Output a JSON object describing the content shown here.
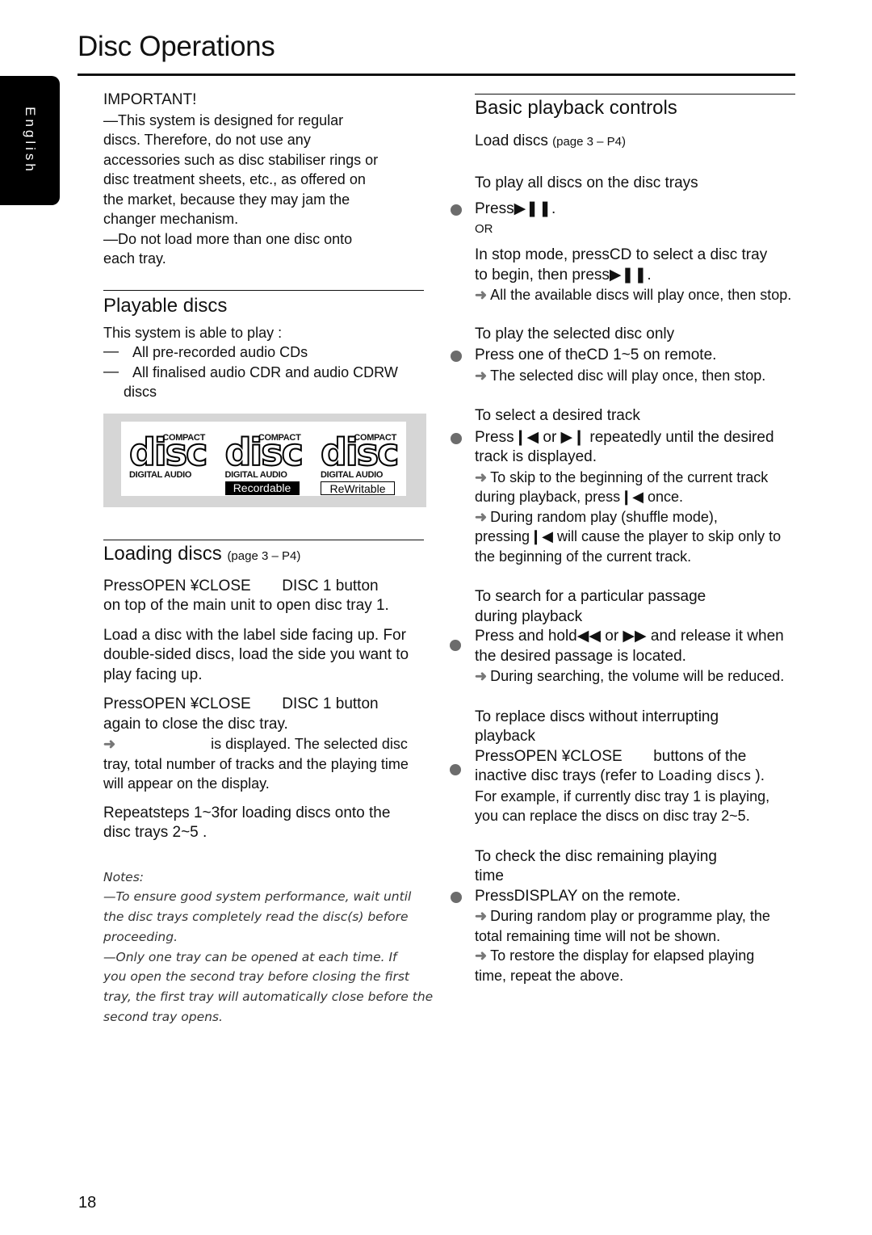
{
  "page": {
    "title": "Disc Operations",
    "language_tab": "English",
    "page_number": "18"
  },
  "important": {
    "heading": "IMPORTANT!",
    "lines": [
      "—This system is designed for regular",
      "discs. Therefore, do not use any",
      "accessories such as disc stabiliser rings or",
      "disc treatment sheets, etc., as offered on",
      "the market, because they may jam the",
      "changer mechanism.",
      "—Do not load more than one disc onto",
      "each tray."
    ]
  },
  "playable_discs": {
    "heading": "Playable discs",
    "intro": "This system is able to play :",
    "dash": "—",
    "items": [
      "All pre-recorded audio CDs",
      "All finalised audio CDR and audio CDRW",
      "discs"
    ],
    "logos": [
      {
        "top": "COMPACT",
        "word": "disc",
        "bottom": "DIGITAL AUDIO",
        "badge": ""
      },
      {
        "top": "COMPACT",
        "word": "disc",
        "bottom": "DIGITAL AUDIO",
        "badge": "Recordable"
      },
      {
        "top": "COMPACT",
        "word": "disc",
        "bottom": "DIGITAL AUDIO",
        "badge": "ReWritable"
      }
    ]
  },
  "loading_discs": {
    "heading": "Loading discs",
    "ref": "(page 3 – P4)",
    "step1_a": "PressOPEN ¥CLOSE",
    "step1_b": "DISC 1  button",
    "step1_c": "on top of the main unit to open disc tray 1.",
    "step2": [
      "Load a disc with the label side facing up. For",
      "double-sided discs, load the side you want to",
      "play facing up."
    ],
    "step3_a": "PressOPEN ¥CLOSE",
    "step3_b": "DISC 1  button",
    "step3_c": "again to close the disc tray.",
    "step3_arrow": "➜",
    "step3_d": "is displayed. The selected disc",
    "step3_e": "tray, total number of tracks and the playing time",
    "step3_f": "will appear on the display.",
    "step4": [
      "Repeatsteps 1~3for loading discs onto the",
      "disc trays 2~5 ."
    ],
    "notes_heading": "Notes:",
    "notes": [
      "—To ensure good system performance, wait until",
      "the disc trays completely read the disc(s) before",
      "proceeding.",
      "—Only one tray can be opened at each time.  If",
      "you open the second tray before closing the first",
      "tray, the first tray will automatically close before the",
      "second tray opens."
    ]
  },
  "basic_playback": {
    "heading": "Basic playback controls",
    "load_label": "Load discs",
    "load_ref": "(page 3 – P4)",
    "arrow": "➜",
    "play_all": {
      "title": "To play all discs on the disc trays",
      "step": "Press▶❚❚.",
      "or": "OR",
      "alt": [
        "In stop mode, pressCD  to select a disc tray",
        "to begin, then press▶❚❚."
      ],
      "note": "All the available discs will play once, then stop."
    },
    "play_selected": {
      "title": "To play the selected disc only",
      "step": "Press one of theCD 1~5  on remote.",
      "note": "The selected disc will play once, then stop."
    },
    "select_track": {
      "title": "To select a desired track",
      "step": [
        "Press❙◀  or  ▶❙  repeatedly until the desired",
        "track is displayed."
      ],
      "note1": [
        "To skip to the beginning of the current track",
        "during playback, press❙◀ once."
      ],
      "note2": [
        "During random play (shuffle mode),",
        "pressing❙◀  will cause the player to skip only to",
        "the beginning of the current track."
      ]
    },
    "search": {
      "title": [
        "To search for a particular passage",
        "during playback"
      ],
      "step": [
        "Press and hold◀◀ or ▶▶ and release it when",
        "the desired passage is located."
      ],
      "note": "During searching, the volume will be reduced."
    },
    "replace": {
      "title": [
        "To replace discs without interrupting",
        "playback"
      ],
      "step_a": "PressOPEN ¥CLOSE",
      "step_b": "buttons of the",
      "step_c": "inactive disc trays (refer to",
      "step_link": "Loading discs",
      "step_d": ").",
      "example": [
        "For example, if currently disc tray 1 is playing,",
        "you can replace the discs on disc tray 2~5."
      ]
    },
    "remaining": {
      "title": [
        "To check the disc remaining playing",
        "time"
      ],
      "step": "PressDISPLAY  on the remote.",
      "note1": [
        "During random play or programme play, the",
        "total remaining time will not be shown."
      ],
      "note2": [
        "To restore the display for elapsed playing",
        "time, repeat the above."
      ]
    }
  }
}
